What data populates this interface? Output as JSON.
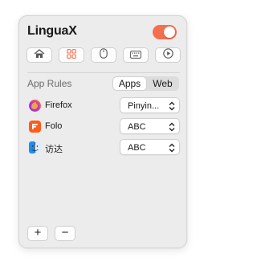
{
  "app": {
    "title": "LinguaX",
    "enabled": true,
    "accent_color": "#f46f4e"
  },
  "toolbar": {
    "buttons": [
      {
        "icon": "home-icon"
      },
      {
        "icon": "grid-icon",
        "active": true
      },
      {
        "icon": "mouse-icon"
      },
      {
        "icon": "keyboard-icon"
      },
      {
        "icon": "play-circle-icon"
      }
    ]
  },
  "rules": {
    "section_label": "App Rules",
    "tabs": [
      "Apps",
      "Web"
    ],
    "selected_tab": "Apps",
    "items": [
      {
        "app": "Firefox",
        "icon": "firefox-icon",
        "input_source": "Pinyin..."
      },
      {
        "app": "Folo",
        "icon": "folo-icon",
        "input_source": "ABC"
      },
      {
        "app": "访达",
        "icon": "finder-icon",
        "input_source": "ABC"
      }
    ]
  },
  "footer": {
    "add_label": "+",
    "remove_label": "−"
  }
}
